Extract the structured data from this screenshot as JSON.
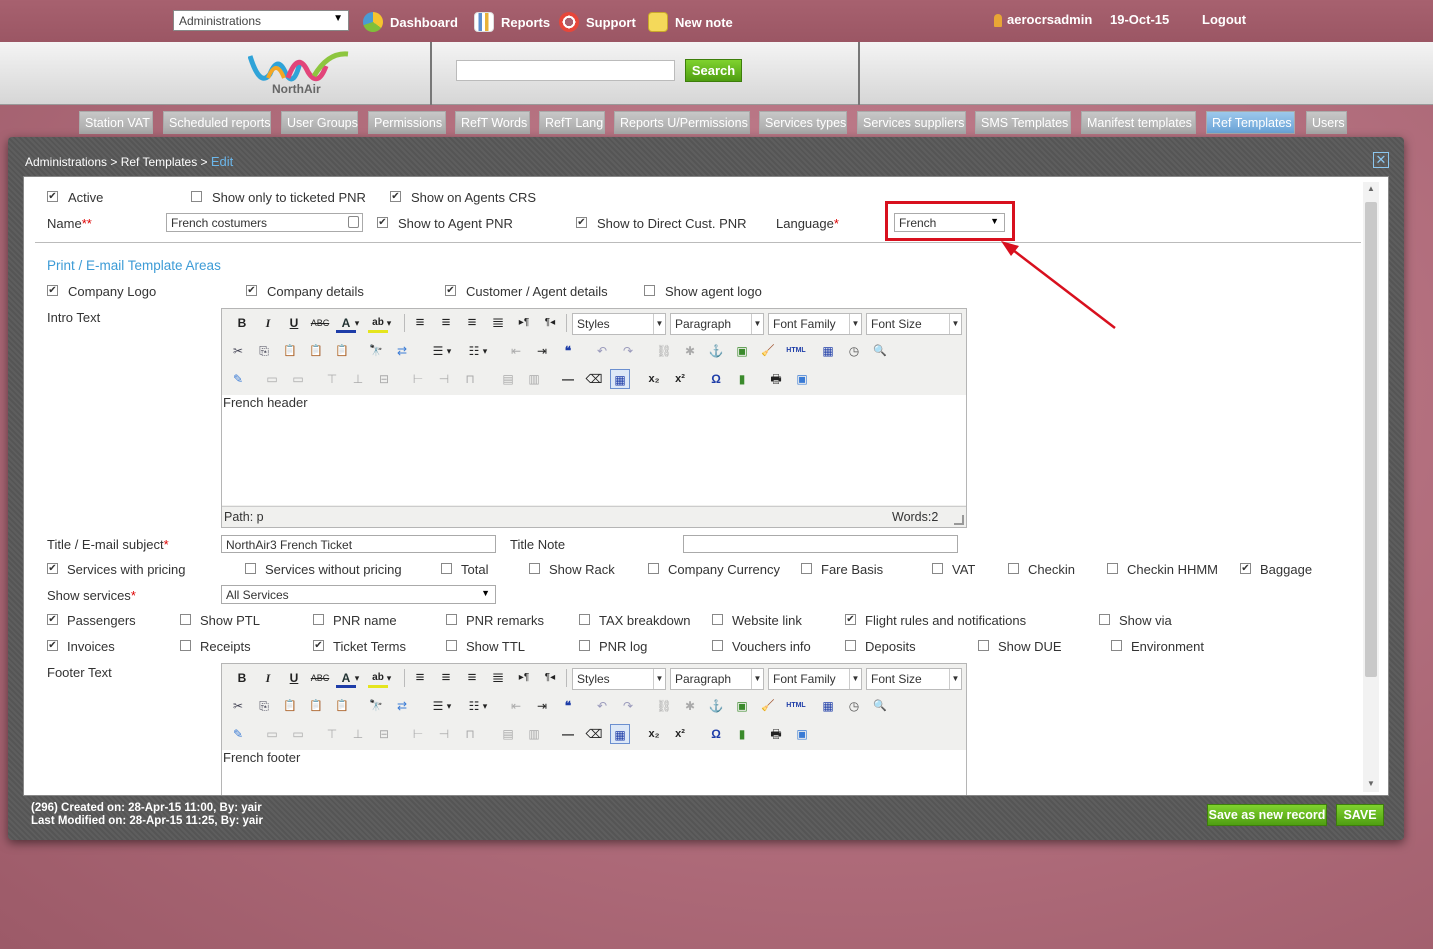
{
  "topbar": {
    "admin_select": "Administrations",
    "nav": [
      {
        "label": "Dashboard",
        "icon": "dashboard-icon"
      },
      {
        "label": "Reports",
        "icon": "reports-icon"
      },
      {
        "label": "Support",
        "icon": "support-icon"
      },
      {
        "label": "New note",
        "icon": "note-icon"
      }
    ],
    "user": "aerocrsadmin",
    "date": "19-Oct-15",
    "logout": "Logout"
  },
  "header": {
    "logo_text": "NorthAir",
    "search_placeholder": "",
    "search_button": "Search"
  },
  "tabs": [
    "Station VAT",
    "Scheduled reports",
    "User Groups",
    "Permissions",
    "RefT Words",
    "RefT Lang",
    "Reports U/Permissions",
    "Services types",
    "Services suppliers",
    "SMS Templates",
    "Manifest templates",
    "Ref Templates",
    "Users"
  ],
  "active_tab": "Ref Templates",
  "breadcrumb": {
    "part1": "Administrations",
    "sep": " > ",
    "part2": "Ref Templates",
    "current": "Edit"
  },
  "form": {
    "active": {
      "label": "Active",
      "checked": true
    },
    "show_only_ticketed": {
      "label": "Show only to ticketed PNR",
      "checked": false
    },
    "show_on_agents_crs": {
      "label": "Show on Agents CRS",
      "checked": true
    },
    "name_label": "Name",
    "name_required": "**",
    "name_value": "French costumers",
    "show_to_agent_pnr": {
      "label": "Show to Agent PNR",
      "checked": true
    },
    "show_to_direct": {
      "label": "Show to Direct Cust. PNR",
      "checked": true
    },
    "language_label": "Language",
    "language_required": "*",
    "language_value": "French",
    "section_title": "Print / E-mail Template Areas",
    "company_logo": {
      "label": "Company Logo",
      "checked": true
    },
    "company_details": {
      "label": "Company details",
      "checked": true
    },
    "customer_agent": {
      "label": "Customer / Agent details",
      "checked": true
    },
    "show_agent_logo": {
      "label": "Show agent logo",
      "checked": false
    },
    "intro_label": "Intro Text",
    "intro_content": "French header",
    "intro_path": "Path: p",
    "intro_words": "Words:2",
    "title_label": "Title / E-mail subject",
    "title_required": "*",
    "title_value": "NorthAir3 French Ticket",
    "title_note_label": "Title Note",
    "title_note_value": "",
    "options_row1": [
      {
        "label": "Services with pricing",
        "checked": true
      },
      {
        "label": "Services without pricing",
        "checked": false
      },
      {
        "label": "Total",
        "checked": false
      },
      {
        "label": "Show Rack",
        "checked": false
      },
      {
        "label": "Company Currency",
        "checked": false
      },
      {
        "label": "Fare Basis",
        "checked": false
      },
      {
        "label": "VAT",
        "checked": false
      },
      {
        "label": "Checkin",
        "checked": false
      },
      {
        "label": "Checkin HHMM",
        "checked": false
      },
      {
        "label": "Baggage",
        "checked": true
      }
    ],
    "show_services_label": "Show services",
    "show_services_required": "*",
    "show_services_value": "All Services",
    "options_row2": [
      {
        "label": "Passengers",
        "checked": true
      },
      {
        "label": "Show PTL",
        "checked": false
      },
      {
        "label": "PNR name",
        "checked": false
      },
      {
        "label": "PNR remarks",
        "checked": false
      },
      {
        "label": "TAX breakdown",
        "checked": false
      },
      {
        "label": "Website link",
        "checked": false
      },
      {
        "label": "Flight rules and notifications",
        "checked": true
      },
      {
        "label": "Show via",
        "checked": false
      }
    ],
    "options_row3": [
      {
        "label": "Invoices",
        "checked": true
      },
      {
        "label": "Receipts",
        "checked": false
      },
      {
        "label": "Ticket Terms",
        "checked": true
      },
      {
        "label": "Show TTL",
        "checked": false
      },
      {
        "label": "PNR log",
        "checked": false
      },
      {
        "label": "Vouchers info",
        "checked": false
      },
      {
        "label": "Deposits",
        "checked": false
      },
      {
        "label": "Show DUE",
        "checked": false
      },
      {
        "label": "Environment",
        "checked": false
      }
    ],
    "footer_label": "Footer Text",
    "footer_content": "French footer"
  },
  "editor_toolbar": {
    "styles": "Styles",
    "paragraph": "Paragraph",
    "font_family": "Font Family",
    "font_size": "Font Size",
    "bold": "B",
    "italic": "I",
    "underline": "U",
    "strike": "ABC",
    "html": "HTML",
    "omega": "Ω",
    "sub": "x₂",
    "sup": "x²"
  },
  "footer": {
    "created": "(296) Created on: 28-Apr-15 11:00, By: yair",
    "modified": "Last Modified on: 28-Apr-15 11:25, By: yair",
    "save_as_new": "Save as new record",
    "save": "SAVE"
  },
  "colors": {
    "accent": "#3c9bd6",
    "highlight": "#d8101e",
    "green": "#4f9e12"
  }
}
